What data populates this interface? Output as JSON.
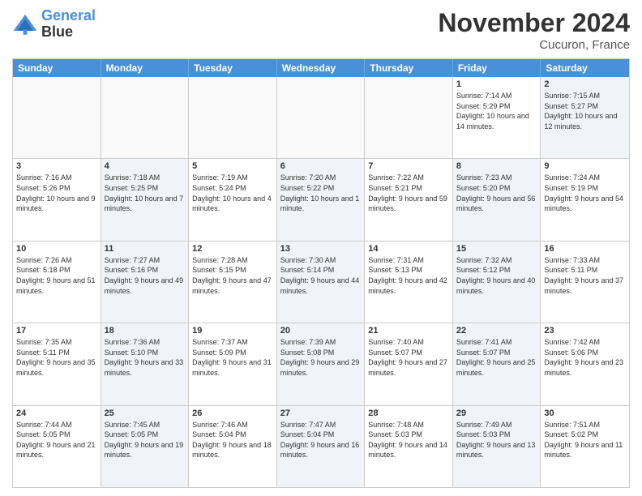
{
  "logo": {
    "line1": "General",
    "line2": "Blue"
  },
  "title": "November 2024",
  "location": "Cucuron, France",
  "header_days": [
    "Sunday",
    "Monday",
    "Tuesday",
    "Wednesday",
    "Thursday",
    "Friday",
    "Saturday"
  ],
  "rows": [
    [
      {
        "day": "",
        "info": "",
        "shaded": false,
        "empty": true
      },
      {
        "day": "",
        "info": "",
        "shaded": false,
        "empty": true
      },
      {
        "day": "",
        "info": "",
        "shaded": false,
        "empty": true
      },
      {
        "day": "",
        "info": "",
        "shaded": false,
        "empty": true
      },
      {
        "day": "",
        "info": "",
        "shaded": false,
        "empty": true
      },
      {
        "day": "1",
        "info": "Sunrise: 7:14 AM\nSunset: 5:29 PM\nDaylight: 10 hours and 14 minutes.",
        "shaded": false,
        "empty": false
      },
      {
        "day": "2",
        "info": "Sunrise: 7:15 AM\nSunset: 5:27 PM\nDaylight: 10 hours and 12 minutes.",
        "shaded": true,
        "empty": false
      }
    ],
    [
      {
        "day": "3",
        "info": "Sunrise: 7:16 AM\nSunset: 5:26 PM\nDaylight: 10 hours and 9 minutes.",
        "shaded": false,
        "empty": false
      },
      {
        "day": "4",
        "info": "Sunrise: 7:18 AM\nSunset: 5:25 PM\nDaylight: 10 hours and 7 minutes.",
        "shaded": true,
        "empty": false
      },
      {
        "day": "5",
        "info": "Sunrise: 7:19 AM\nSunset: 5:24 PM\nDaylight: 10 hours and 4 minutes.",
        "shaded": false,
        "empty": false
      },
      {
        "day": "6",
        "info": "Sunrise: 7:20 AM\nSunset: 5:22 PM\nDaylight: 10 hours and 1 minute.",
        "shaded": true,
        "empty": false
      },
      {
        "day": "7",
        "info": "Sunrise: 7:22 AM\nSunset: 5:21 PM\nDaylight: 9 hours and 59 minutes.",
        "shaded": false,
        "empty": false
      },
      {
        "day": "8",
        "info": "Sunrise: 7:23 AM\nSunset: 5:20 PM\nDaylight: 9 hours and 56 minutes.",
        "shaded": true,
        "empty": false
      },
      {
        "day": "9",
        "info": "Sunrise: 7:24 AM\nSunset: 5:19 PM\nDaylight: 9 hours and 54 minutes.",
        "shaded": false,
        "empty": false
      }
    ],
    [
      {
        "day": "10",
        "info": "Sunrise: 7:26 AM\nSunset: 5:18 PM\nDaylight: 9 hours and 51 minutes.",
        "shaded": false,
        "empty": false
      },
      {
        "day": "11",
        "info": "Sunrise: 7:27 AM\nSunset: 5:16 PM\nDaylight: 9 hours and 49 minutes.",
        "shaded": true,
        "empty": false
      },
      {
        "day": "12",
        "info": "Sunrise: 7:28 AM\nSunset: 5:15 PM\nDaylight: 9 hours and 47 minutes.",
        "shaded": false,
        "empty": false
      },
      {
        "day": "13",
        "info": "Sunrise: 7:30 AM\nSunset: 5:14 PM\nDaylight: 9 hours and 44 minutes.",
        "shaded": true,
        "empty": false
      },
      {
        "day": "14",
        "info": "Sunrise: 7:31 AM\nSunset: 5:13 PM\nDaylight: 9 hours and 42 minutes.",
        "shaded": false,
        "empty": false
      },
      {
        "day": "15",
        "info": "Sunrise: 7:32 AM\nSunset: 5:12 PM\nDaylight: 9 hours and 40 minutes.",
        "shaded": true,
        "empty": false
      },
      {
        "day": "16",
        "info": "Sunrise: 7:33 AM\nSunset: 5:11 PM\nDaylight: 9 hours and 37 minutes.",
        "shaded": false,
        "empty": false
      }
    ],
    [
      {
        "day": "17",
        "info": "Sunrise: 7:35 AM\nSunset: 5:11 PM\nDaylight: 9 hours and 35 minutes.",
        "shaded": false,
        "empty": false
      },
      {
        "day": "18",
        "info": "Sunrise: 7:36 AM\nSunset: 5:10 PM\nDaylight: 9 hours and 33 minutes.",
        "shaded": true,
        "empty": false
      },
      {
        "day": "19",
        "info": "Sunrise: 7:37 AM\nSunset: 5:09 PM\nDaylight: 9 hours and 31 minutes.",
        "shaded": false,
        "empty": false
      },
      {
        "day": "20",
        "info": "Sunrise: 7:39 AM\nSunset: 5:08 PM\nDaylight: 9 hours and 29 minutes.",
        "shaded": true,
        "empty": false
      },
      {
        "day": "21",
        "info": "Sunrise: 7:40 AM\nSunset: 5:07 PM\nDaylight: 9 hours and 27 minutes.",
        "shaded": false,
        "empty": false
      },
      {
        "day": "22",
        "info": "Sunrise: 7:41 AM\nSunset: 5:07 PM\nDaylight: 9 hours and 25 minutes.",
        "shaded": true,
        "empty": false
      },
      {
        "day": "23",
        "info": "Sunrise: 7:42 AM\nSunset: 5:06 PM\nDaylight: 9 hours and 23 minutes.",
        "shaded": false,
        "empty": false
      }
    ],
    [
      {
        "day": "24",
        "info": "Sunrise: 7:44 AM\nSunset: 5:05 PM\nDaylight: 9 hours and 21 minutes.",
        "shaded": false,
        "empty": false
      },
      {
        "day": "25",
        "info": "Sunrise: 7:45 AM\nSunset: 5:05 PM\nDaylight: 9 hours and 19 minutes.",
        "shaded": true,
        "empty": false
      },
      {
        "day": "26",
        "info": "Sunrise: 7:46 AM\nSunset: 5:04 PM\nDaylight: 9 hours and 18 minutes.",
        "shaded": false,
        "empty": false
      },
      {
        "day": "27",
        "info": "Sunrise: 7:47 AM\nSunset: 5:04 PM\nDaylight: 9 hours and 16 minutes.",
        "shaded": true,
        "empty": false
      },
      {
        "day": "28",
        "info": "Sunrise: 7:48 AM\nSunset: 5:03 PM\nDaylight: 9 hours and 14 minutes.",
        "shaded": false,
        "empty": false
      },
      {
        "day": "29",
        "info": "Sunrise: 7:49 AM\nSunset: 5:03 PM\nDaylight: 9 hours and 13 minutes.",
        "shaded": true,
        "empty": false
      },
      {
        "day": "30",
        "info": "Sunrise: 7:51 AM\nSunset: 5:02 PM\nDaylight: 9 hours and 11 minutes.",
        "shaded": false,
        "empty": false
      }
    ]
  ]
}
